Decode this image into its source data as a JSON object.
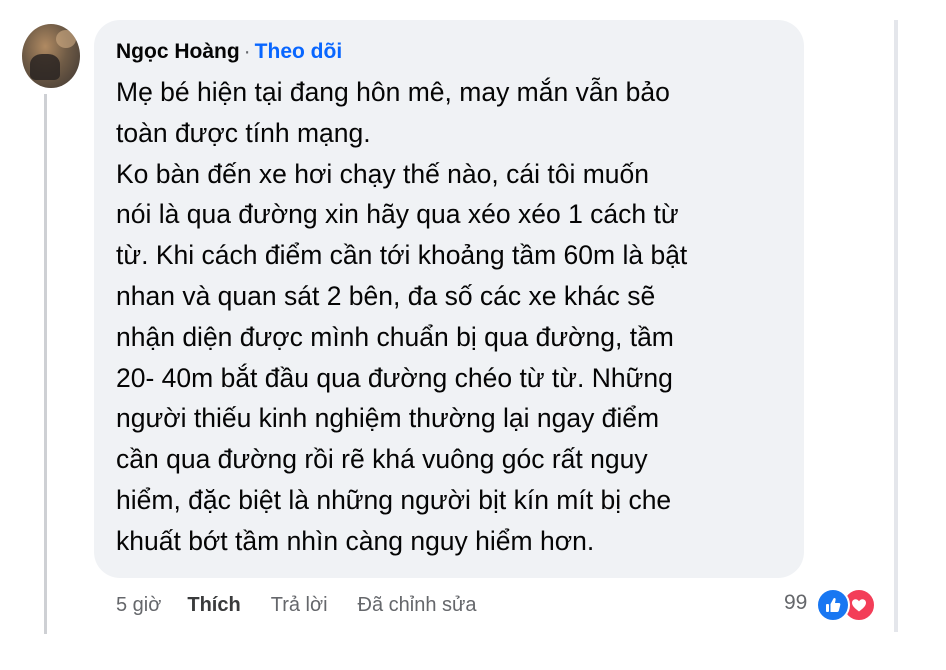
{
  "comment": {
    "author": "Ngọc Hoàng",
    "separator": "·",
    "follow_label": "Theo dõi",
    "lines": [
      "Mẹ bé hiện tại đang hôn mê, may mắn vẫn bảo",
      "toàn được tính mạng.",
      "Ko bàn đến xe hơi chạy thế nào, cái tôi muốn",
      "nói là qua đường xin hãy qua xéo xéo 1 cách từ",
      "từ. Khi cách điểm cần tới khoảng tầm 60m là bật",
      "nhan và quan sát 2 bên, đa số các xe khác sẽ",
      "nhận diện được mình chuẩn bị qua đường, tầm",
      "20- 40m bắt đầu qua đường chéo từ từ. Những",
      "người thiếu kinh nghiệm thường lại ngay điểm",
      "cần qua đường rồi rẽ khá vuông góc rất nguy",
      "hiểm, đặc biệt là những người bịt kín mít bị che",
      "khuất bớt tầm nhìn càng nguy hiểm hơn."
    ]
  },
  "actions": {
    "time": "5 giờ",
    "like_label": "Thích",
    "reply_label": "Trả lời",
    "edited_label": "Đã chỉnh sửa"
  },
  "reactions": {
    "count": "99",
    "icons": [
      "like-icon",
      "love-icon"
    ],
    "colors": {
      "like": "#1877f2",
      "love": "#f33e58",
      "follow": "#0866ff",
      "bubble": "#f0f2f5"
    }
  }
}
